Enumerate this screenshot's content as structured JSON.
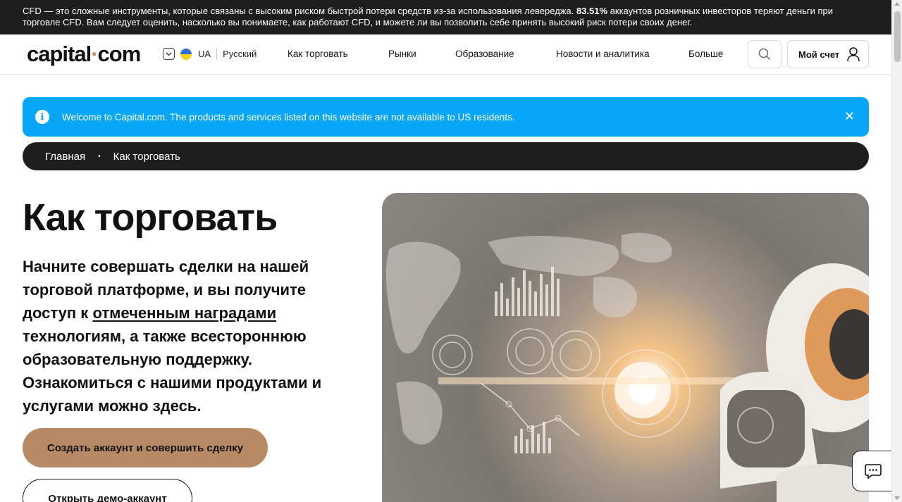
{
  "risk_banner": {
    "text_before": "CFD — это сложные инструменты, которые связаны с высоким риском быстрой потери средств из-за использования левереджа. ",
    "percent": "83.51%",
    "text_after": " аккаунтов розничных инвесторов теряют деньги при торговле CFD. Вам следует оценить, насколько вы понимаете, как работают CFD, и можете ли вы позволить себе принять высокий риск потери своих денег."
  },
  "header": {
    "logo_left": "capital",
    "logo_dot": "·",
    "logo_right": "com",
    "region": "UA",
    "language": "Русский",
    "nav": [
      "Как торговать",
      "Рынки",
      "Образование",
      "Новости и аналитика",
      "Больше"
    ],
    "account_label": "Мой счет"
  },
  "notice": {
    "info_glyph": "i",
    "text": "Welcome to Capital.com. The products and services listed on this website are not available to US residents.",
    "close_glyph": "✕"
  },
  "breadcrumb": {
    "home": "Главная",
    "separator": "•",
    "current": "Как торговать"
  },
  "hero": {
    "title": "Как торговать",
    "lead_start": "Начните совершать сделки на нашей торговой платформе, и вы получите доступ к ",
    "lead_link": "отмеченным наградами",
    "lead_end": " технологиям, а также всестороннюю образовательную поддержку. Ознакомиться с нашими продуктами и услугами можно здесь.",
    "cta_primary": "Создать аккаунт и совершить сделку",
    "cta_demo": "Открыть демо-аккаунт"
  },
  "colors": {
    "accent_brown": "#b88a64",
    "notice_blue": "#06a6f8",
    "dark": "#1e1e1e"
  },
  "icons": {
    "search": "search-icon",
    "account": "user-icon",
    "chat": "chat-icon",
    "info": "info-icon",
    "close": "close-icon",
    "chevron": "chevron-down-icon"
  }
}
